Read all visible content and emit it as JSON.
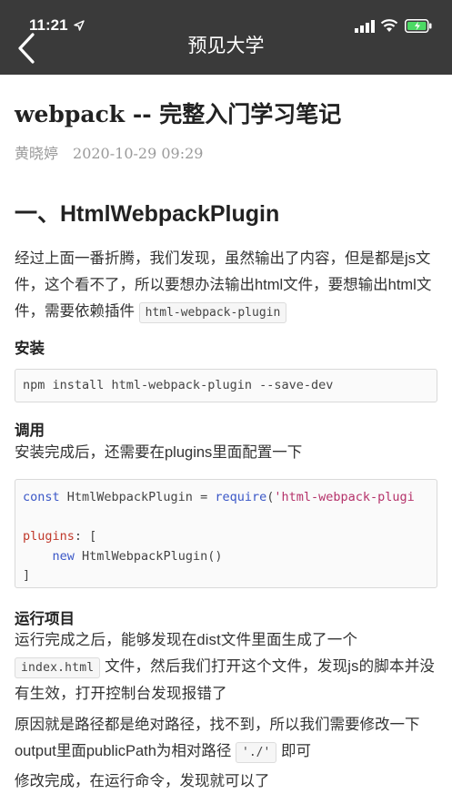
{
  "status_bar": {
    "time": "11:21"
  },
  "nav": {
    "title": "预见大学",
    "back_icon": "chevron-left-icon"
  },
  "article": {
    "title": "webpack -- 完整入门学习笔记",
    "author": "黄晓婷",
    "date": "2020-10-29 09:29",
    "section_title": "一、HtmlWebpackPlugin",
    "intro_text": "经过上面一番折腾，我们发现，虽然输出了内容，但是都是js文件，这个看不了，所以要想办法输出html文件，要想输出html文件，需要依赖插件",
    "intro_code": "html-webpack-plugin",
    "install_heading": "安装",
    "install_cmd": "npm install html-webpack-plugin --save-dev",
    "use_heading": "调用",
    "use_text": "安装完成后，还需要在plugins里面配置一下",
    "code": {
      "line1_kw": "const",
      "line1_name": " HtmlWebpackPlugin = ",
      "line1_fn": "require",
      "line1_paren": "(",
      "line1_str": "'html-webpack-plugi",
      "line3_prop": "plugins",
      "line3_rest": ": [",
      "line4_kw": "new",
      "line4_rest": " HtmlWebpackPlugin()",
      "line5": "]"
    },
    "run_heading": "运行项目",
    "run_text_1": "运行完成之后，能够发现在dist文件里面生成了一个",
    "run_code": "index.html",
    "run_text_2": "文件，然后我们打开这个文件，发现js的脚本并没有生效，打开控制台发现报错了",
    "reason_text_1": "原因就是路径都是绝对路径，找不到，所以我们需要修改一下output里面publicPath为相对路径",
    "reason_code": "'./'",
    "reason_text_2": "即可",
    "final_text": "修改完成，在运行命令，发现就可以了"
  },
  "colors": {
    "header_bg": "#3a3a3a",
    "keyword": "#3a57c7",
    "string": "#b5326a",
    "property": "#c0392b",
    "battery": "#4cd964"
  }
}
